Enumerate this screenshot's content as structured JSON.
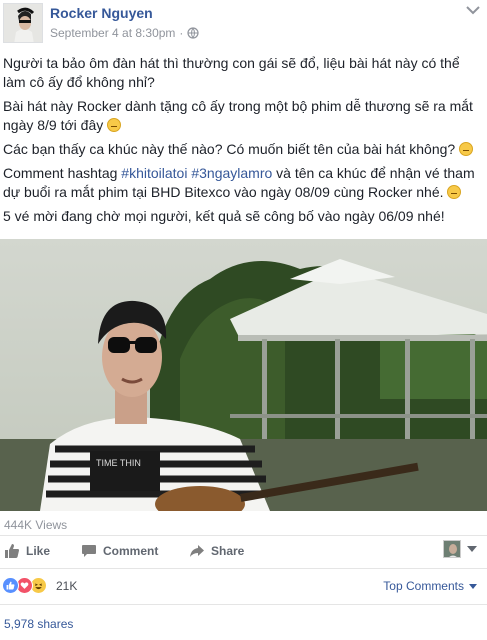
{
  "post": {
    "author": "Rocker Nguyen",
    "timestamp": "September 4 at 8:30pm",
    "privacy_icon": "globe-icon",
    "paragraphs": {
      "p1": "Người ta bảo ôm đàn hát thì thường con gái sẽ đổ, liệu bài hát này có thể làm cô ấy đổ không nhỉ?",
      "p2": "Bài hát này Rocker dành tặng cô ấy trong một bộ phim dễ thương sẽ ra mắt ngày 8/9 tới đây",
      "p3": "Các bạn thấy ca khúc này thế nào? Có muốn biết tên của bài hát không?",
      "p4_before": "Comment hashtag ",
      "p4_tag1": "#khitoilatoi",
      "p4_space": " ",
      "p4_tag2": "#3ngaylamro",
      "p4_after": " và tên ca khúc để nhận vé tham dự buổi ra mắt phim tại BHD Bitexco vào ngày 08/09 cùng Rocker nhé.",
      "p5": "5 vé mời đang chờ mọi người, kết quả sẽ công bố vào ngày 06/09 nhé!"
    },
    "video": {
      "shirt_text": "TIME THIN"
    },
    "views": "444K Views"
  },
  "actions": {
    "like": "Like",
    "comment": "Comment",
    "share": "Share"
  },
  "reactions": {
    "icons": [
      "like-icon",
      "love-icon",
      "haha-icon"
    ],
    "count": "21K",
    "top_comments": "Top Comments"
  },
  "shares": "5,978 shares",
  "colors": {
    "link": "#365899",
    "meta": "#90949c",
    "like_blue": "#5890ff",
    "love_red": "#f25268",
    "haha_yellow": "#f7c948"
  }
}
